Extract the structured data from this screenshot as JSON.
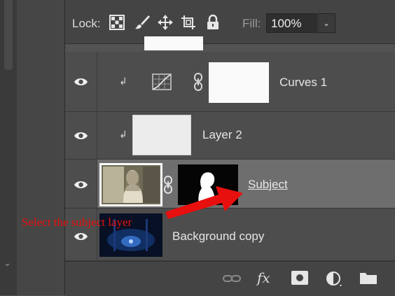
{
  "panel": {
    "lock_label": "Lock:",
    "lock_icons": [
      "lock-transparent-pixels-icon",
      "lock-image-pixels-icon",
      "lock-position-icon",
      "lock-artboard-icon",
      "lock-all-icon"
    ],
    "fill_label": "Fill:",
    "fill_value": "100%"
  },
  "layers": [
    {
      "name": "Curves 1",
      "visible": true,
      "clipped": true,
      "type": "adjustment-curves"
    },
    {
      "name": "Layer 2",
      "visible": true,
      "clipped": true,
      "type": "pixel"
    },
    {
      "name": "Subject",
      "visible": true,
      "clipped": false,
      "selected": true,
      "has_mask": true,
      "type": "pixel"
    },
    {
      "name": "Background copy",
      "visible": true,
      "clipped": false,
      "type": "pixel"
    }
  ],
  "bottom_bar": {
    "icons": [
      "link-layers-icon",
      "layer-style-fx-icon",
      "add-mask-icon",
      "adjustment-layer-icon",
      "new-group-folder-icon"
    ],
    "fx_label": "fx"
  },
  "annotation": {
    "text": "Select the subject layer",
    "color": "#e8100e"
  },
  "colors": {
    "panel_bg": "#535353",
    "row_bg": "#4d4d4d",
    "selected_row_bg": "#6e6e6e",
    "annotation_red": "#e8100e"
  }
}
